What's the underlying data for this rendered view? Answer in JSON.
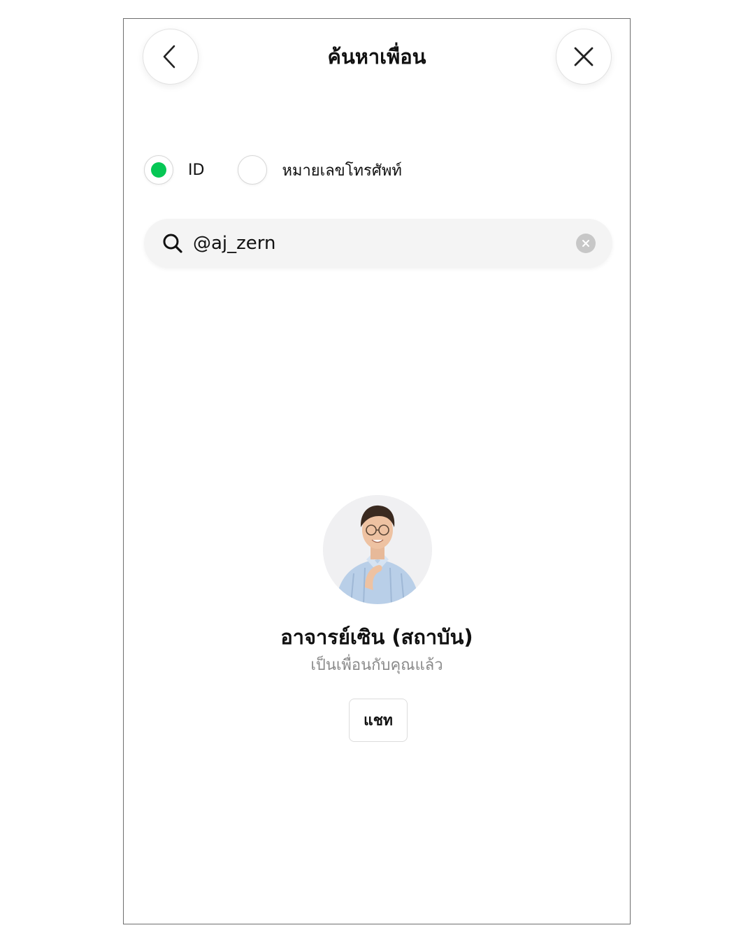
{
  "header": {
    "title": "ค้นหาเพื่อน",
    "back_icon": "chevron-left-icon",
    "close_icon": "close-icon"
  },
  "search_type": {
    "options": [
      {
        "label": "ID",
        "selected": true
      },
      {
        "label": "หมายเลขโทรศัพท์",
        "selected": false
      }
    ]
  },
  "search": {
    "value": "@aj_zern",
    "search_icon": "search-icon",
    "clear_icon": "clear-icon"
  },
  "result": {
    "name": "อาจารย์เซิน (สถาบัน)",
    "status": "เป็นเพื่อนกับคุณแล้ว",
    "chat_label": "แชท"
  },
  "colors": {
    "accent": "#06c755",
    "search_bg": "#f4f4f4",
    "status_text": "#8a8a8a"
  }
}
